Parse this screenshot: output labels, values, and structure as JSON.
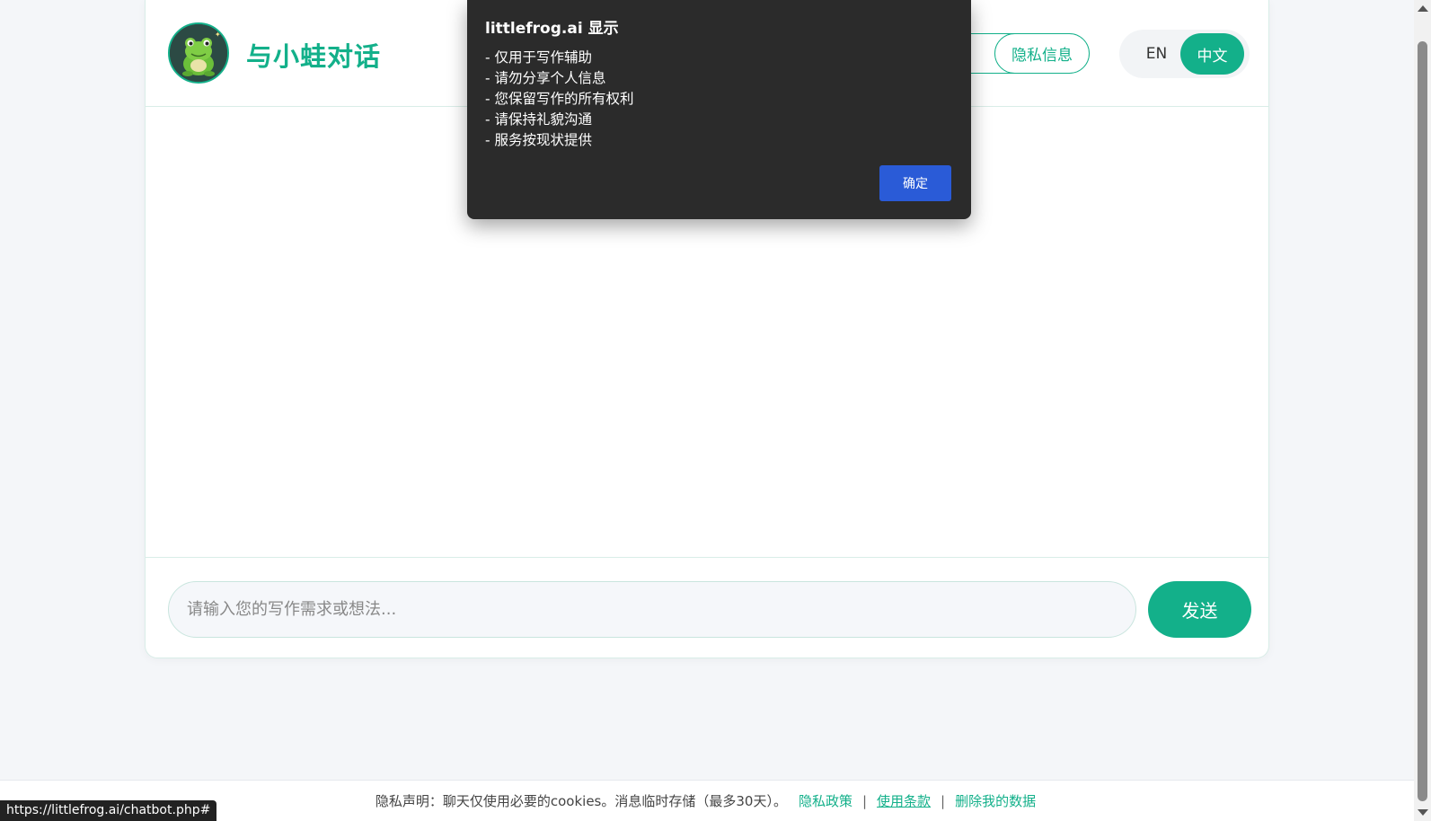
{
  "header": {
    "title": "与小蛙对话",
    "hidden_button_label": "",
    "privacy_button_label": "隐私信息",
    "lang_en": "EN",
    "lang_zh": "中文"
  },
  "chat": {
    "input_placeholder": "请输入您的写作需求或想法...",
    "send_label": "发送"
  },
  "footer": {
    "statement": "隐私声明：聊天仅使用必要的cookies。消息临时存储（最多30天）。",
    "links": [
      "隐私政策",
      "使用条款",
      "删除我的数据"
    ],
    "separator": "|"
  },
  "status_bar": {
    "url": "https://littlefrog.ai/chatbot.php#"
  },
  "dialog": {
    "title": "littlefrog.ai 显示",
    "lines": [
      "- 仅用于写作辅助",
      "- 请勿分享个人信息",
      "- 您保留写作的所有权利",
      "- 请保持礼貌沟通",
      "- 服务按现状提供"
    ],
    "ok_label": "确定"
  },
  "colors": {
    "accent": "#13b08a",
    "dialog_bg": "#2b2b2b",
    "dialog_button": "#2a5bd7",
    "page_bg": "#f4f6f9"
  }
}
